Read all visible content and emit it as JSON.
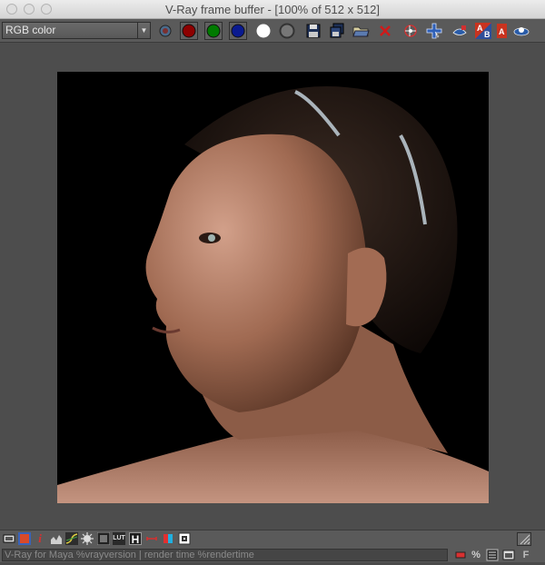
{
  "window": {
    "title": "V-Ray frame buffer - [100% of 512 x 512]"
  },
  "toolbar": {
    "channel_select": "RGB color",
    "buttons": [
      {
        "name": "display-rgb-channels-icon"
      },
      {
        "name": "red-channel-icon",
        "color": "#9b0000"
      },
      {
        "name": "green-channel-icon",
        "color": "#00a000"
      },
      {
        "name": "blue-channel-icon",
        "color": "#0a1aa0"
      },
      {
        "name": "alpha-channel-icon",
        "color": "#ffffff"
      },
      {
        "name": "monochrome-icon"
      },
      {
        "name": "save-image-icon"
      },
      {
        "name": "save-all-icon"
      },
      {
        "name": "load-image-icon"
      },
      {
        "name": "clear-image-icon"
      },
      {
        "name": "track-mouse-icon"
      },
      {
        "name": "region-render-icon"
      },
      {
        "name": "render-last-icon"
      },
      {
        "name": "compare-ab-icon"
      },
      {
        "name": "ab-horizontal-icon"
      },
      {
        "name": "ab-vertical-icon"
      }
    ],
    "ab_label_a": "A",
    "ab_label_b": "B",
    "single_a": "A"
  },
  "bottom_toolbar": {
    "icons": [
      "display-colors-icon",
      "color-picker-icon",
      "info-icon",
      "levels-icon",
      "curve-icon",
      "exposure-icon",
      "srgb-icon",
      "lut-icon",
      "history-icon",
      "clamp-icon",
      "stereo-icon",
      "pixel-aspect-icon"
    ],
    "info_glyph": "i",
    "lut_label": "LUT",
    "history_label": "H"
  },
  "status": {
    "text": "V-Ray for Maya %vrayversion | render time %rendertime",
    "percent_label": "%",
    "f_label": "F"
  }
}
